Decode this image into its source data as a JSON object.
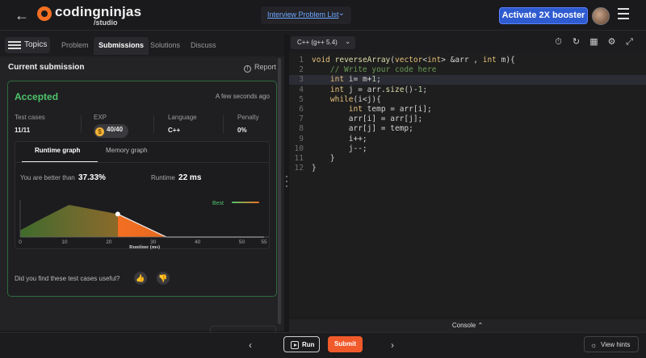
{
  "header": {
    "brand_name": "codingninjas",
    "brand_sub": "/studio",
    "problem_list_label": "Interview Problem List",
    "booster_label": "Activate 2X booster"
  },
  "tabs": {
    "topics": "Topics",
    "items": [
      "Problem",
      "Submissions",
      "Solutions",
      "Discuss"
    ],
    "active": "Submissions"
  },
  "submission": {
    "section_title": "Current submission",
    "report_label": "Report",
    "status": "Accepted",
    "time_ago": "A few seconds ago",
    "stats": {
      "test_cases_label": "Test cases",
      "test_cases_value": "11/11",
      "exp_label": "EXP",
      "exp_value": "40/40",
      "language_label": "Language",
      "language_value": "C++",
      "penalty_label": "Penalty",
      "penalty_value": "0%"
    },
    "graph_tabs": [
      "Runtime graph",
      "Memory graph"
    ],
    "better_label": "You are better than",
    "better_value": "37.33%",
    "runtime_label": "Runtime",
    "runtime_value": "22 ms",
    "useful_question": "Did you find these test cases useful?"
  },
  "chart_data": {
    "type": "area",
    "xlabel": "Runtime (ms)",
    "x_ticks": [
      "0",
      "10",
      "20",
      "30",
      "40",
      "50",
      "55"
    ],
    "xlim": [
      0,
      55
    ],
    "legend": "Best",
    "marker_x": 22,
    "distribution": [
      [
        0,
        0.2
      ],
      [
        5,
        0.55
      ],
      [
        11,
        0.95
      ],
      [
        22,
        0.68
      ],
      [
        33,
        0.0
      ],
      [
        55,
        0.0
      ]
    ],
    "colors": {
      "green": "#4f7a36",
      "orange": "#f36f21"
    }
  },
  "editor": {
    "language": "C++ (g++ 5.4)",
    "lines": [
      "void reverseArray(vector<int> &arr , int m){",
      "    // Write your code here",
      "    int i= m+1;",
      "    int j = arr.size()-1;",
      "    while(i<j){",
      "        int temp = arr[i];",
      "        arr[i] = arr[j];",
      "        arr[j] = temp;",
      "        i++;",
      "        j--;",
      "    }",
      "}"
    ],
    "highlight_line": 3
  },
  "bottom": {
    "console_label": "Console",
    "run_label": "Run",
    "submit_label": "Submit",
    "hints_label": "View hints"
  }
}
